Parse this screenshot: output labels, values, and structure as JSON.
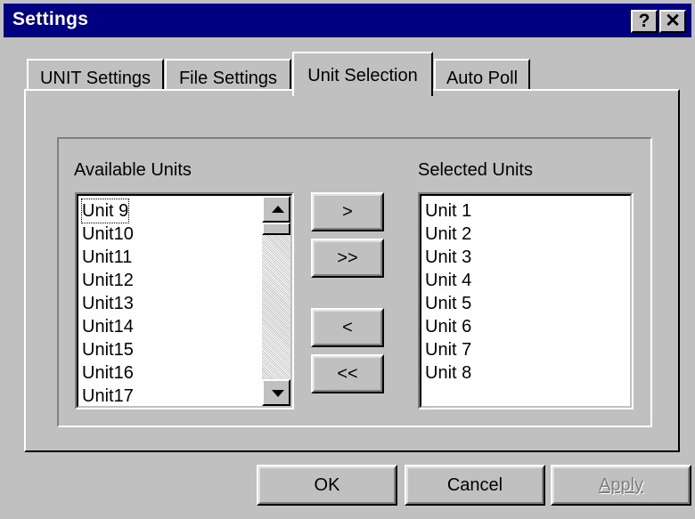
{
  "window": {
    "title": "Settings",
    "help_label": "?",
    "close_label": "✕"
  },
  "tabs": [
    {
      "label": "UNIT Settings",
      "active": false
    },
    {
      "label": "File Settings",
      "active": false
    },
    {
      "label": "Unit Selection",
      "active": true
    },
    {
      "label": "Auto Poll",
      "active": false
    }
  ],
  "available": {
    "label": "Available Units",
    "items": [
      "Unit 9",
      "Unit10",
      "Unit11",
      "Unit12",
      "Unit13",
      "Unit14",
      "Unit15",
      "Unit16",
      "Unit17"
    ],
    "focused_item": "Unit 9"
  },
  "selected": {
    "label": "Selected Units",
    "items": [
      "Unit 1",
      "Unit 2",
      "Unit 3",
      "Unit 4",
      "Unit 5",
      "Unit 6",
      "Unit 7",
      "Unit 8"
    ]
  },
  "transfer_buttons": {
    "add": ">",
    "add_all": ">>",
    "remove": "<",
    "remove_all": "<<"
  },
  "dialog_buttons": {
    "ok": "OK",
    "cancel": "Cancel",
    "apply": "Apply",
    "apply_disabled": true
  }
}
